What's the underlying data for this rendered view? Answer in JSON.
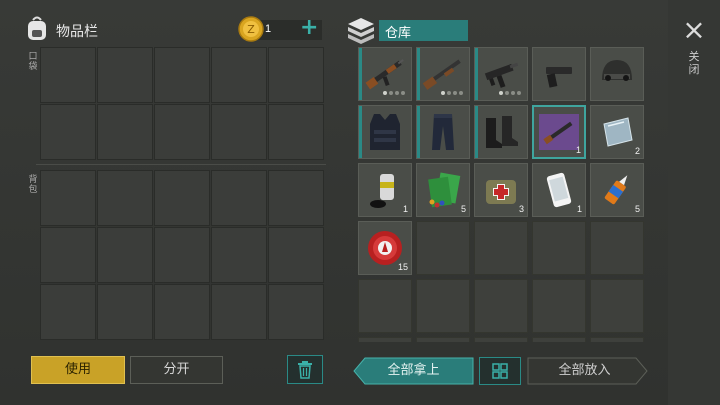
{
  "header": {
    "inventory_title": "物品栏",
    "coin_count": "1",
    "add_label": "+",
    "storage_title": "仓库"
  },
  "sections": {
    "pocket": "口袋",
    "backpack": "背包"
  },
  "buttons": {
    "use": "使用",
    "split": "分开",
    "take_all": "全部拿上",
    "put_all": "全部放入"
  },
  "close": {
    "icon": "×",
    "label": "关闭"
  },
  "storage_items": [
    {
      "name": "assault-rifle",
      "count": ""
    },
    {
      "name": "shotgun",
      "count": ""
    },
    {
      "name": "submachine-gun",
      "count": ""
    },
    {
      "name": "pistol",
      "count": ""
    },
    {
      "name": "combat-helmet",
      "count": ""
    },
    {
      "name": "tactical-vest",
      "count": ""
    },
    {
      "name": "tactical-pants",
      "count": ""
    },
    {
      "name": "combat-boots",
      "count": ""
    },
    {
      "name": "rifle-blueprint",
      "count": "1"
    },
    {
      "name": "glass-plate",
      "count": "2"
    },
    {
      "name": "spray-can",
      "count": "1"
    },
    {
      "name": "seed-packets",
      "count": "5"
    },
    {
      "name": "first-aid-kit",
      "count": "3"
    },
    {
      "name": "smartphone",
      "count": "1"
    },
    {
      "name": "glue-bottle",
      "count": "5"
    },
    {
      "name": "bottle-cap",
      "count": "15"
    }
  ],
  "colors": {
    "teal": "#2a8a86",
    "use_button": "#c9a227",
    "coin": "#d9a520"
  }
}
